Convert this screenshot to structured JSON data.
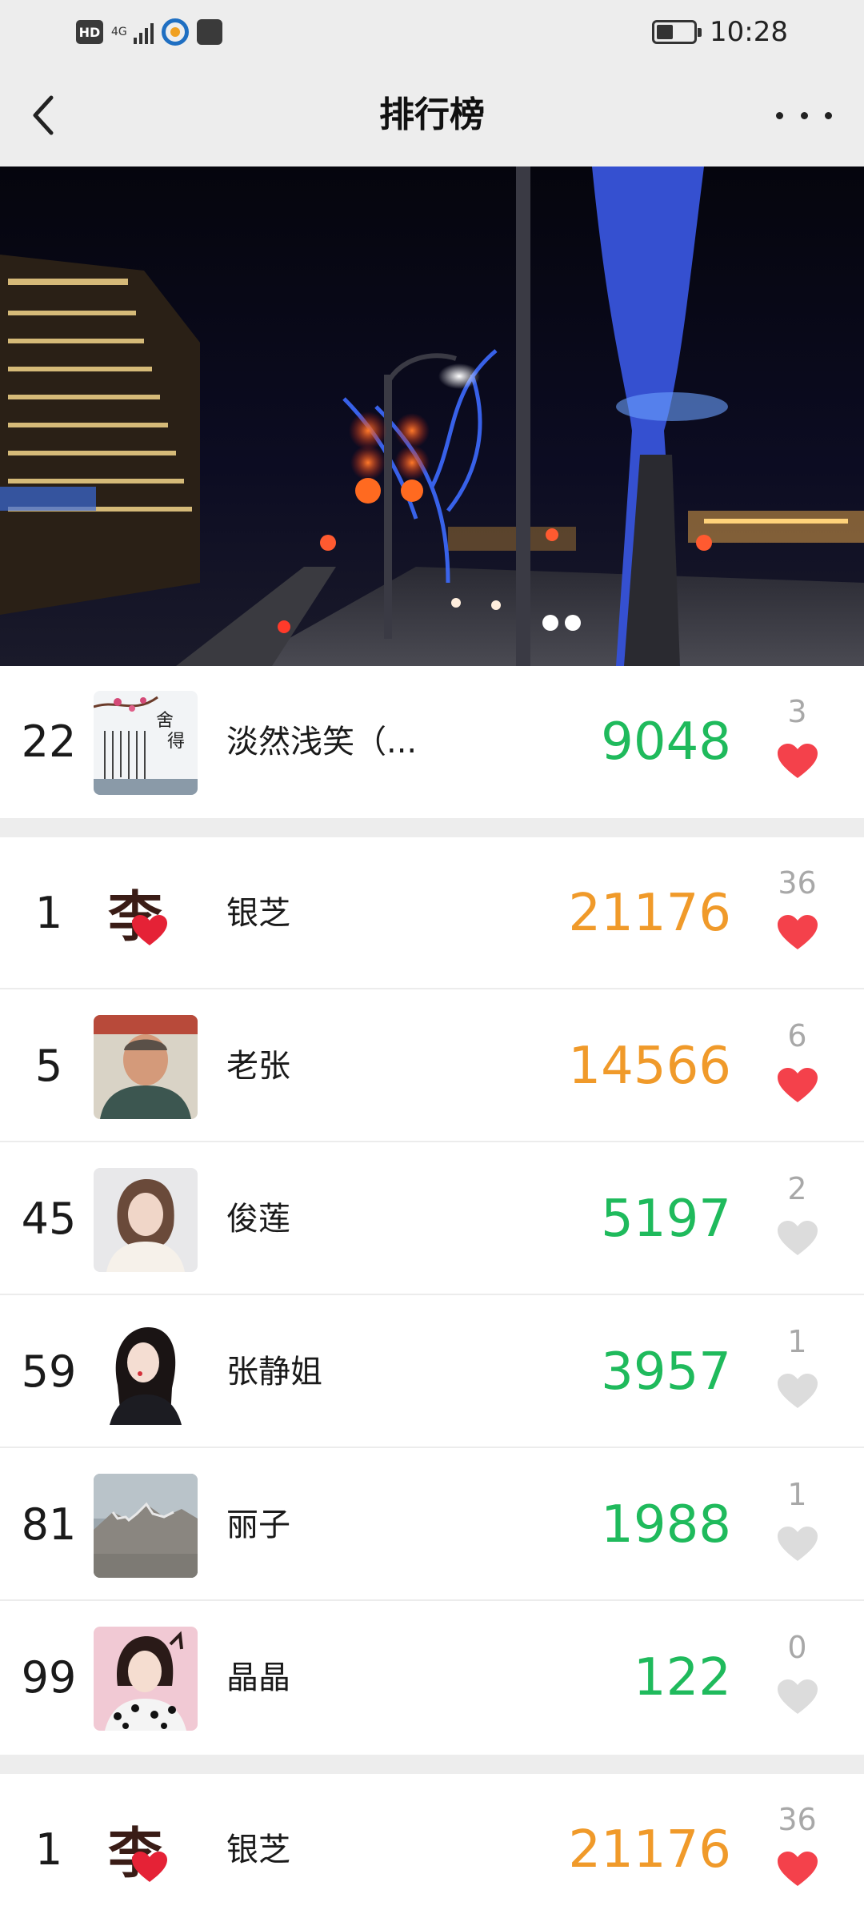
{
  "status_bar": {
    "hd": "HD",
    "network": "4G",
    "time": "10:28"
  },
  "header": {
    "title": "排行榜"
  },
  "colors": {
    "steps_green": "#1fba5c",
    "steps_orange": "#f09a2a",
    "heart_liked": "#f4414b",
    "heart_unliked": "#dcdcdc"
  },
  "my_rank": {
    "rank": "22",
    "name": "淡然浅笑（...",
    "steps": "9048",
    "likes": "3",
    "liked": true,
    "color": "green"
  },
  "ranking": [
    {
      "rank": "1",
      "name": "银芝",
      "steps": "21176",
      "likes": "36",
      "liked": true,
      "color": "orange",
      "avatar": "logo"
    },
    {
      "rank": "5",
      "name": "老张",
      "steps": "14566",
      "likes": "6",
      "liked": true,
      "color": "orange",
      "avatar": "man"
    },
    {
      "rank": "45",
      "name": "俊莲",
      "steps": "5197",
      "likes": "2",
      "liked": false,
      "color": "green",
      "avatar": "woman1"
    },
    {
      "rank": "59",
      "name": "张静姐",
      "steps": "3957",
      "likes": "1",
      "liked": false,
      "color": "green",
      "avatar": "woman2"
    },
    {
      "rank": "81",
      "name": "丽子",
      "steps": "1988",
      "likes": "1",
      "liked": false,
      "color": "green",
      "avatar": "mountain"
    },
    {
      "rank": "99",
      "name": "晶晶",
      "steps": "122",
      "likes": "0",
      "liked": false,
      "color": "green",
      "avatar": "woman3"
    }
  ],
  "champion": {
    "rank": "1",
    "name": "银芝",
    "steps": "21176",
    "likes": "36",
    "liked": true,
    "color": "orange"
  }
}
